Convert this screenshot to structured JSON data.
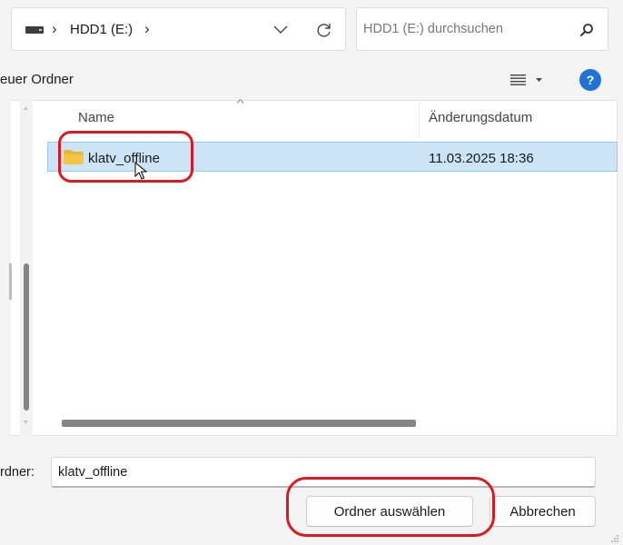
{
  "address": {
    "separator": "›",
    "breadcrumb": "HDD1 (E:)",
    "trailing_separator": "›"
  },
  "search": {
    "placeholder": "HDD1 (E:) durchsuchen"
  },
  "toolbar": {
    "new_folder_label": "euer Ordner",
    "help_label": "?"
  },
  "columns": {
    "name": "Name",
    "date": "Änderungsdatum"
  },
  "rows": [
    {
      "name": "klatv_offline",
      "date": "11.03.2025 18:36",
      "selected": true
    }
  ],
  "footer": {
    "folder_label": "rdner:",
    "folder_value": "klatv_offline",
    "select_button": "Ordner auswählen",
    "cancel_button": "Abbrechen"
  },
  "colors": {
    "selection": "#cce4f7",
    "selection_border": "#99c9ef",
    "highlight": "#d81b22",
    "help_blue": "#1f72d6",
    "folder_yellow": "#f4c542"
  },
  "icons": [
    "drive-icon",
    "chevron-down-icon",
    "refresh-icon",
    "search-icon",
    "view-options-icon",
    "help-icon",
    "folder-icon",
    "mouse-cursor-icon"
  ]
}
